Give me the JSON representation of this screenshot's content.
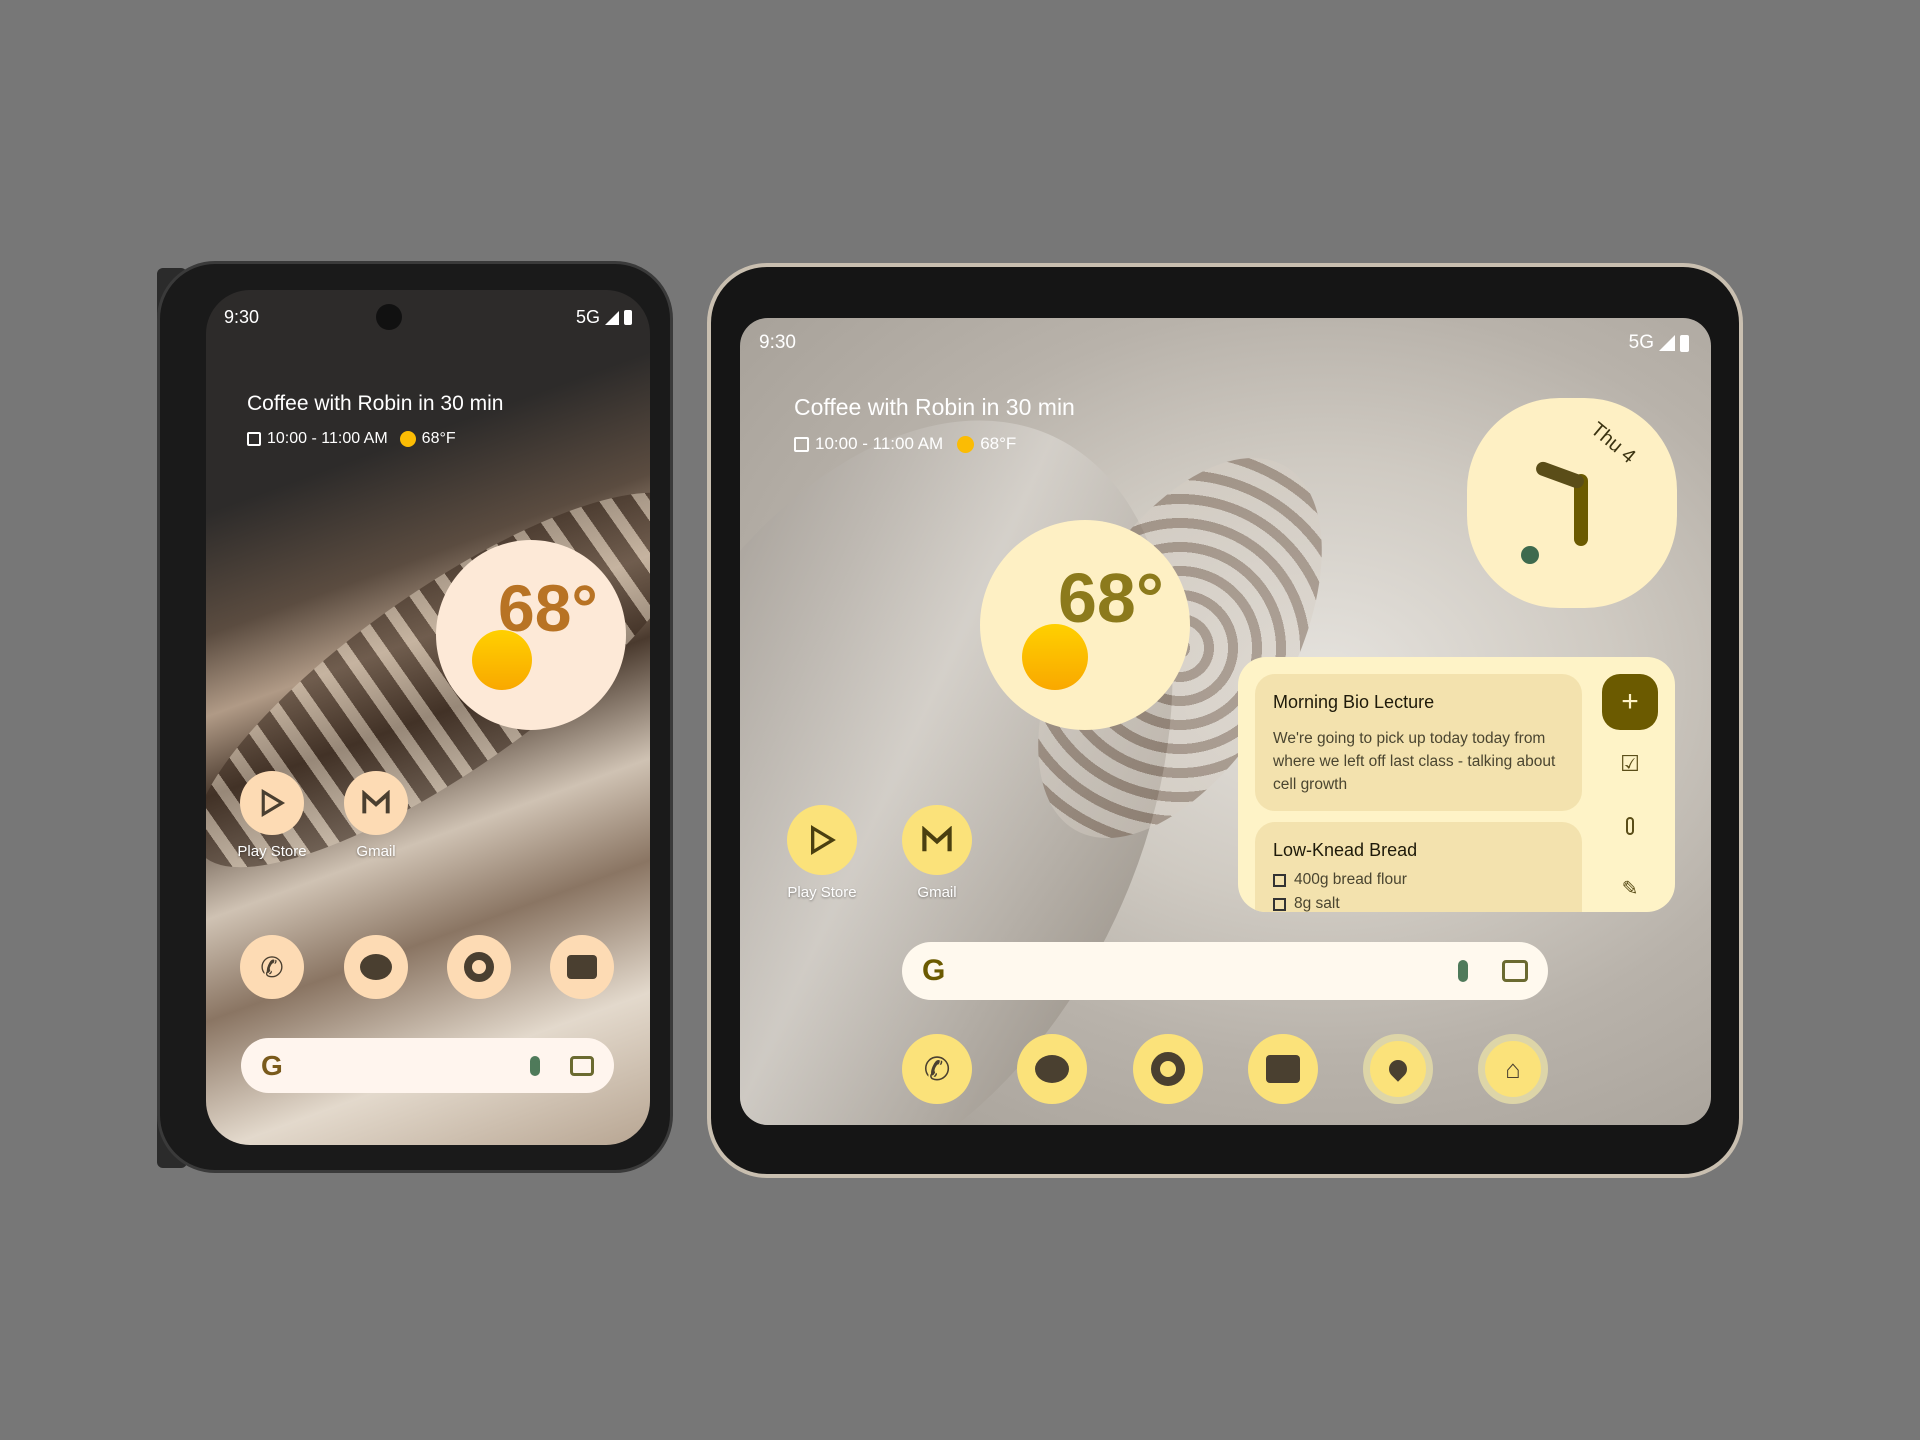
{
  "small_phone": {
    "status": {
      "time": "9:30",
      "network": "5G"
    },
    "event": {
      "title": "Coffee with Robin in 30 min",
      "time": "10:00 - 11:00 AM",
      "temp": "68°F"
    },
    "weather": {
      "temp": "68°"
    },
    "apps": [
      {
        "label": "Play Store",
        "icon": "play-store-icon"
      },
      {
        "label": "Gmail",
        "icon": "gmail-icon"
      }
    ],
    "dock": [
      "phone-icon",
      "messages-icon",
      "chrome-icon",
      "camera-icon"
    ],
    "accent": "#fddbb4"
  },
  "large_phone": {
    "status": {
      "time": "9:30",
      "network": "5G"
    },
    "event": {
      "title": "Coffee with Robin in 30 min",
      "time": "10:00 - 11:00 AM",
      "temp": "68°F"
    },
    "weather": {
      "temp": "68°"
    },
    "clock": {
      "date": "Thu 4"
    },
    "notes": [
      {
        "title": "Morning Bio Lecture",
        "body": "We're going to pick up today today from where we left off last class - talking about cell growth"
      },
      {
        "title": "Low-Knead Bread",
        "items": [
          "400g bread flour",
          "8g salt"
        ]
      }
    ],
    "apps": [
      {
        "label": "Play Store",
        "icon": "play-store-icon"
      },
      {
        "label": "Gmail",
        "icon": "gmail-icon"
      }
    ],
    "dock": [
      "phone-icon",
      "messages-icon",
      "chrome-icon",
      "camera-icon",
      "maps-icon",
      "home-icon"
    ],
    "accent": "#fbe27a"
  }
}
